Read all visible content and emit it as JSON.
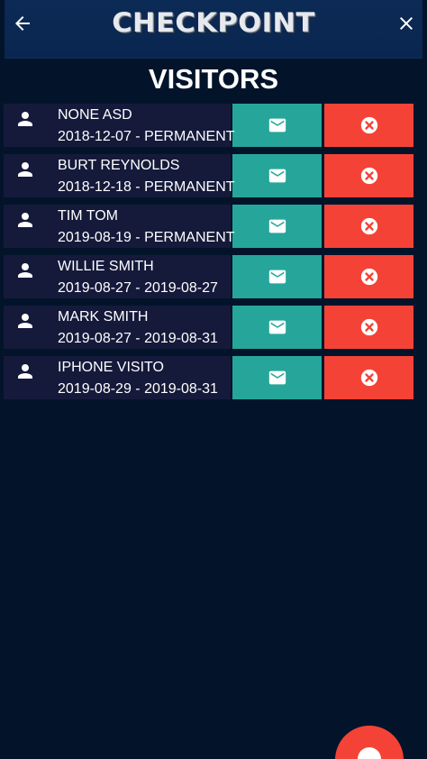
{
  "header": {
    "brand": "CHECKPOINT",
    "back_icon": "arrow-left-icon",
    "close_icon": "close-icon"
  },
  "page": {
    "title": "VISITORS"
  },
  "visitors": [
    {
      "name": "NONE ASD",
      "dates": "2018-12-07 - PERMANENT"
    },
    {
      "name": "BURT REYNOLDS",
      "dates": "2018-12-18 - PERMANENT"
    },
    {
      "name": "TIM TOM",
      "dates": "2019-08-19 - PERMANENT"
    },
    {
      "name": "WILLIE SMITH",
      "dates": "2019-08-27 - 2019-08-27"
    },
    {
      "name": "MARK SMITH",
      "dates": "2019-08-27 - 2019-08-31"
    },
    {
      "name": "IPHONE VISITO",
      "dates": "2019-08-29 - 2019-08-31"
    }
  ],
  "colors": {
    "background": "#03142a",
    "header": "#0b2a55",
    "row": "#151a3b",
    "mail_button": "#26a69a",
    "delete_button": "#f44336",
    "fab": "#f44336"
  },
  "icons": {
    "person": "person-icon",
    "mail": "mail-icon",
    "delete": "delete-circle-icon",
    "fab": "add-icon"
  }
}
